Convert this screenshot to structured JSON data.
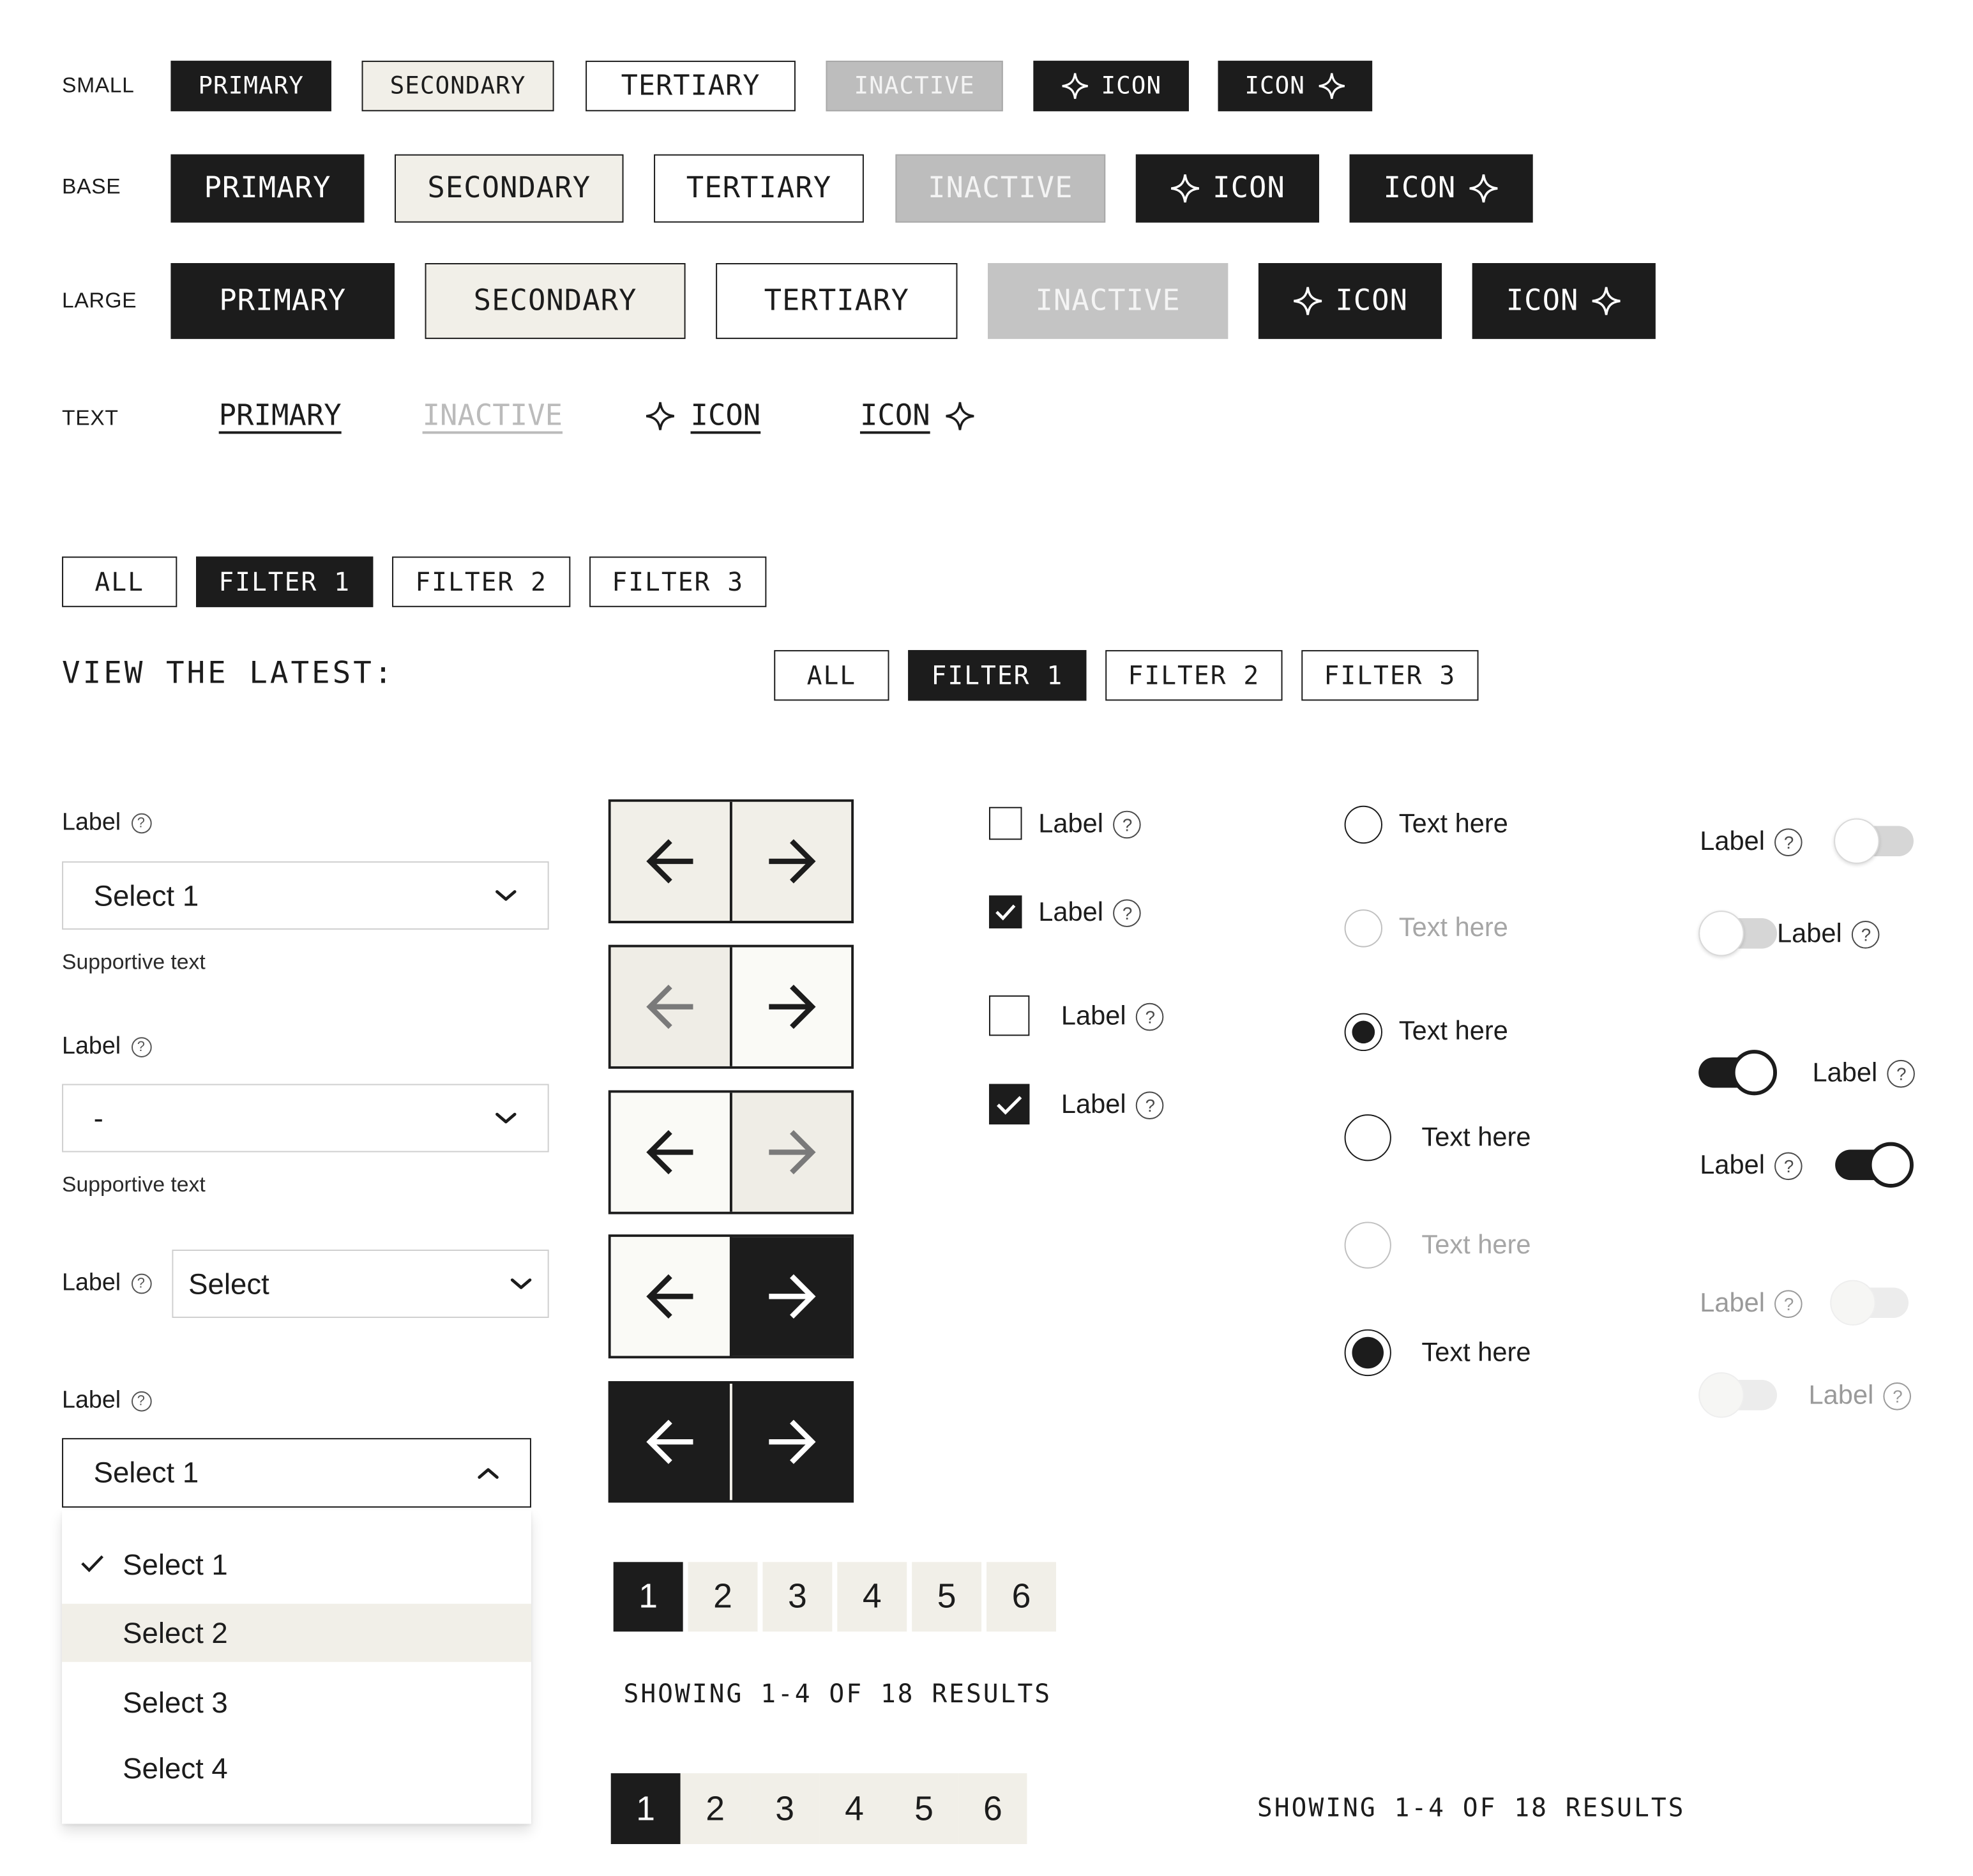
{
  "buttons": {
    "rows": {
      "small": "SMALL",
      "base": "BASE",
      "large": "LARGE",
      "text": "TEXT"
    },
    "primary": "PRIMARY",
    "secondary": "SECONDARY",
    "tertiary": "TERTIARY",
    "inactive": "INACTIVE",
    "icon": "ICON"
  },
  "filters": {
    "items": [
      "ALL",
      "FILTER 1",
      "FILTER 2",
      "FILTER 3"
    ],
    "active_index": 1,
    "view_label": "VIEW THE LATEST:"
  },
  "selects": {
    "label": "Label",
    "help": "?",
    "supportive": "Supportive text",
    "field1_value": "Select 1",
    "field2_value": "-",
    "field3_value": "Select",
    "field4_value": "Select 1",
    "options": [
      "Select 1",
      "Select 2",
      "Select 3",
      "Select 4"
    ],
    "selected_option": "Select 1",
    "highlighted_option": "Select 2"
  },
  "checkboxes": {
    "label": "Label",
    "help": "?"
  },
  "radios": {
    "text": "Text here"
  },
  "toggles": {
    "label": "Label",
    "help": "?"
  },
  "pagination": {
    "pages": [
      "1",
      "2",
      "3",
      "4",
      "5",
      "6"
    ],
    "current": "1",
    "showing": "SHOWING 1-4 OF 18 RESULTS"
  },
  "icons": {
    "sparkle": "sparkle-icon",
    "arrow_left": "arrow-left-icon",
    "arrow_right": "arrow-right-icon",
    "chevron_down": "chevron-down-icon",
    "chevron_up": "chevron-up-icon",
    "check": "check-icon",
    "help": "help-circle-icon"
  },
  "colors": {
    "ink": "#1c1c1c",
    "cream": "#f1efe8",
    "inactive": "#bdbdbd",
    "white": "#ffffff"
  }
}
